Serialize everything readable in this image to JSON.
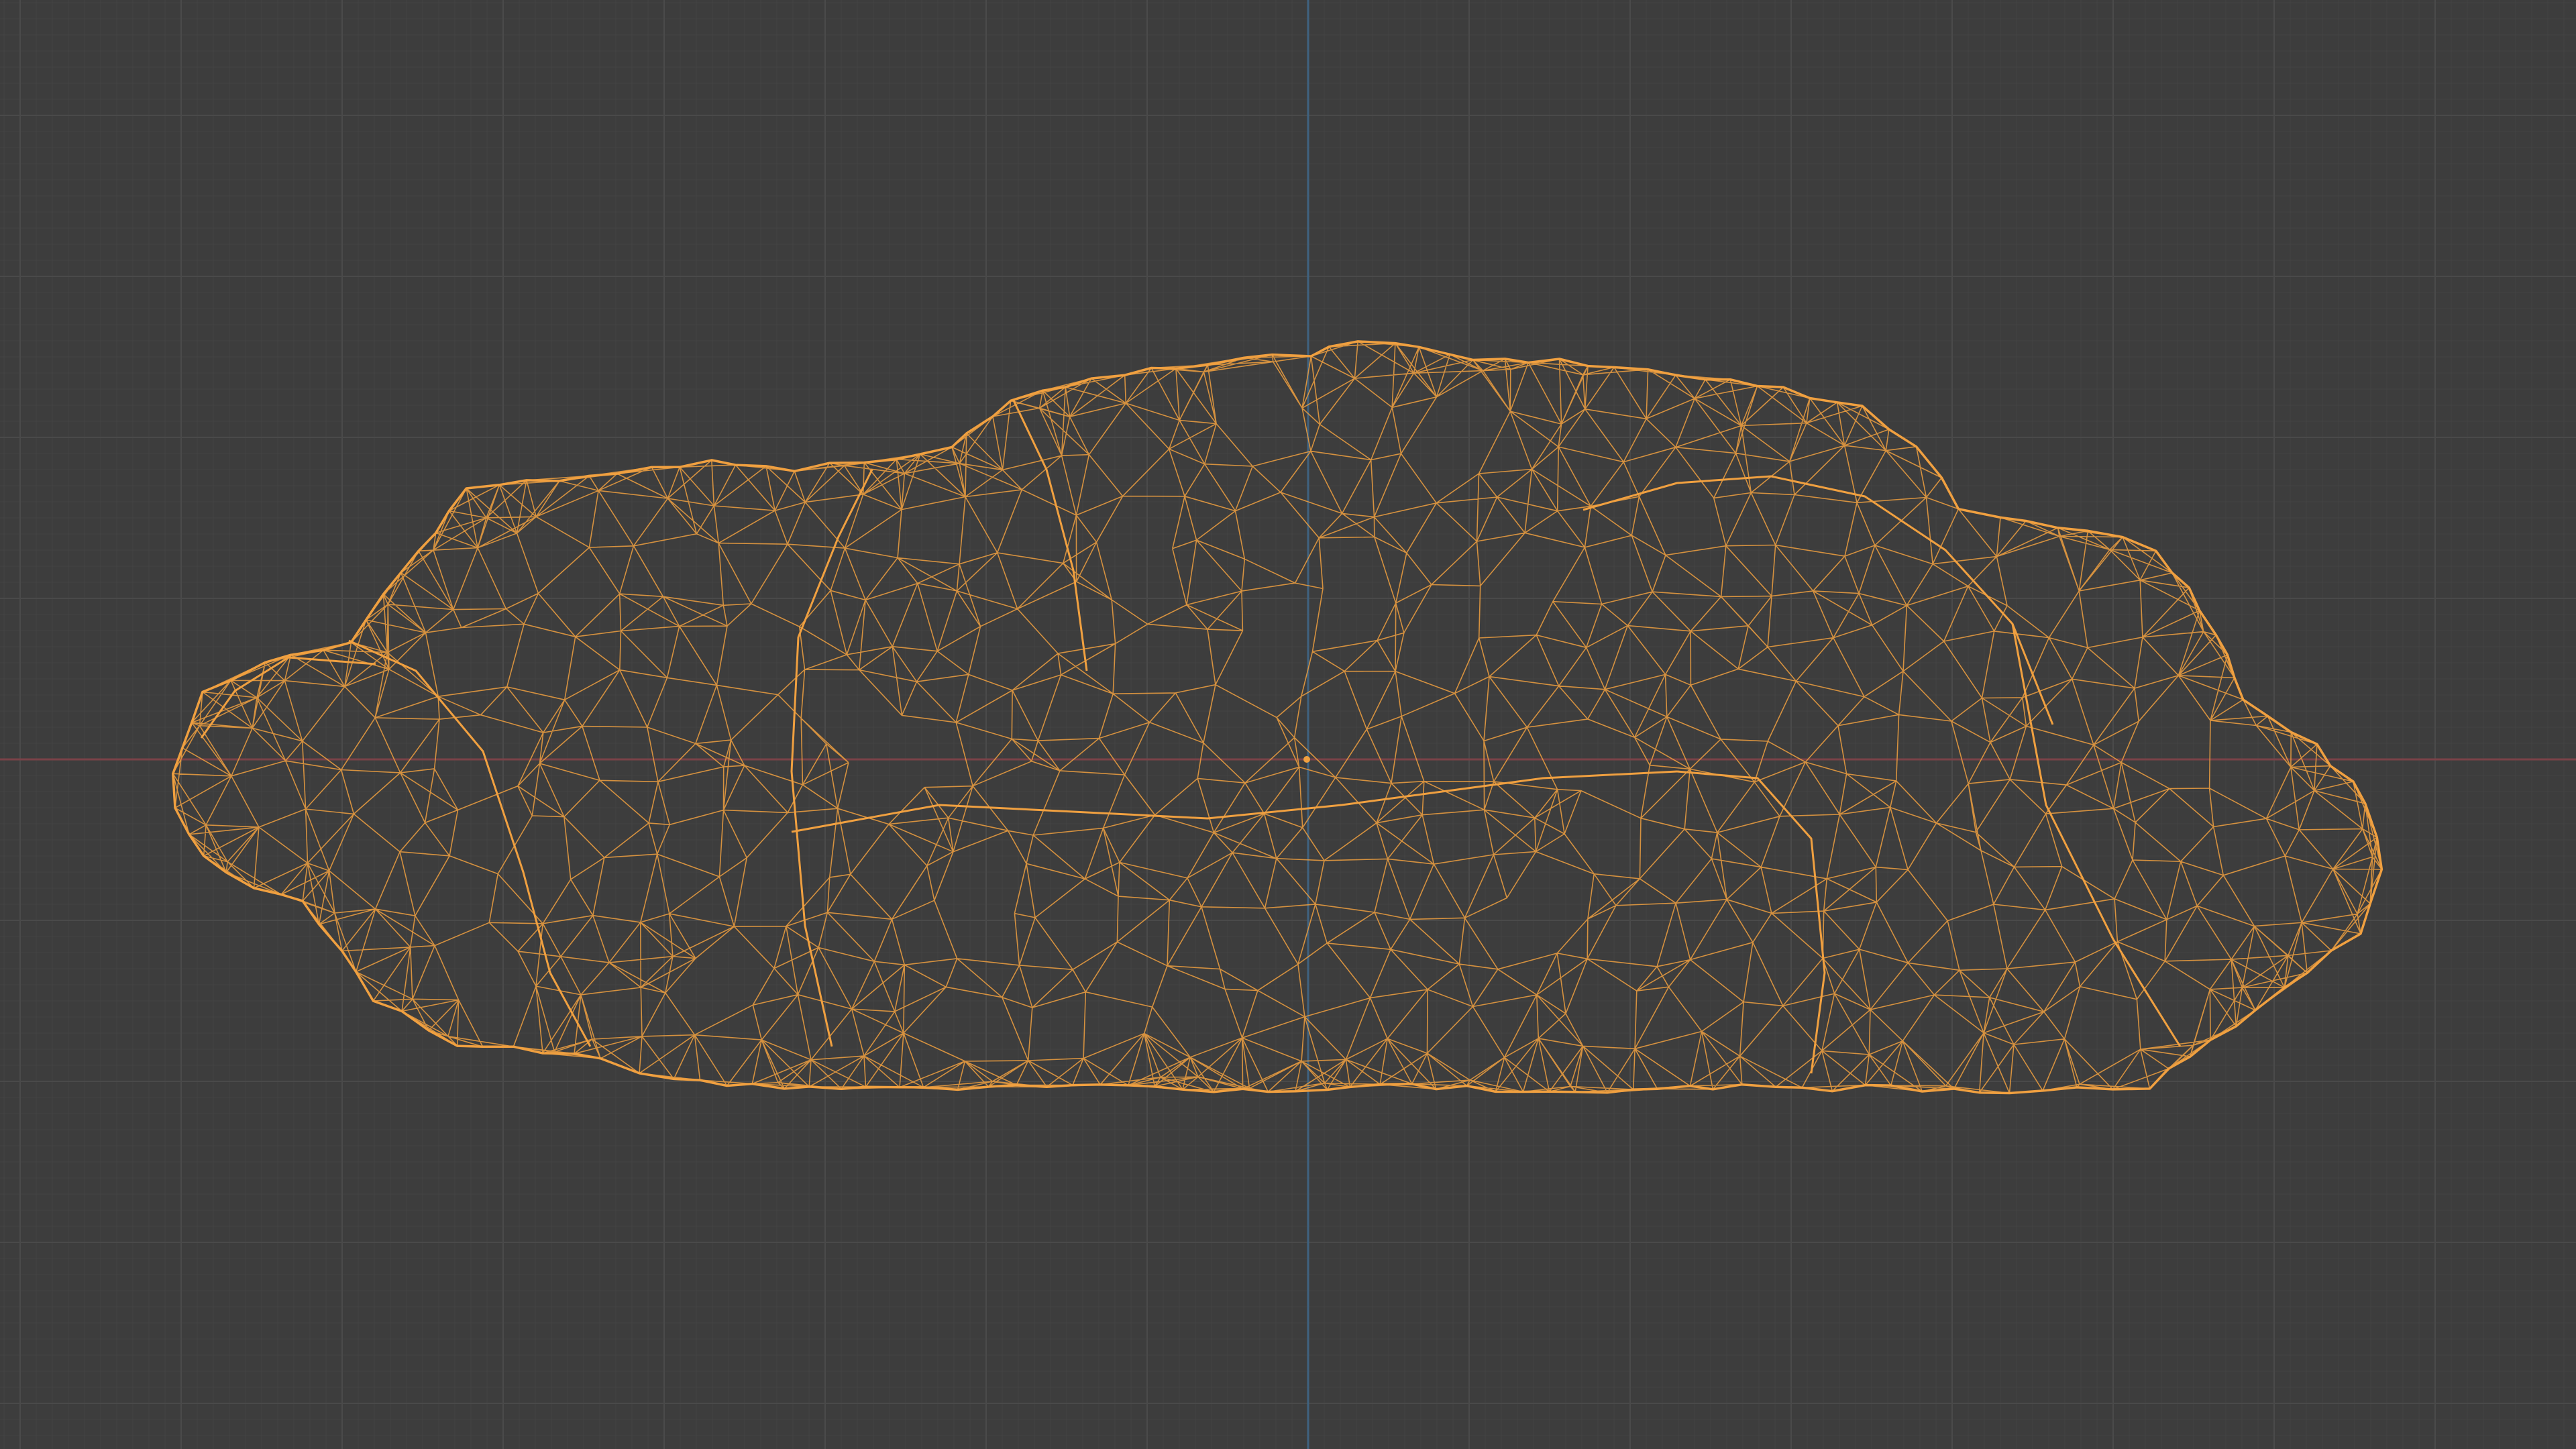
{
  "viewport": {
    "background_color": "#3d3d3d",
    "grid_minor_color": "#444444",
    "grid_major_color": "#4a4a4a",
    "x_axis_color": "#7a4248",
    "y_axis_color": "#3f6280",
    "wireframe_color": "#f0a040",
    "object_icon": "selected-mesh-wireframe",
    "origin_marker": "object-origin-dot"
  }
}
